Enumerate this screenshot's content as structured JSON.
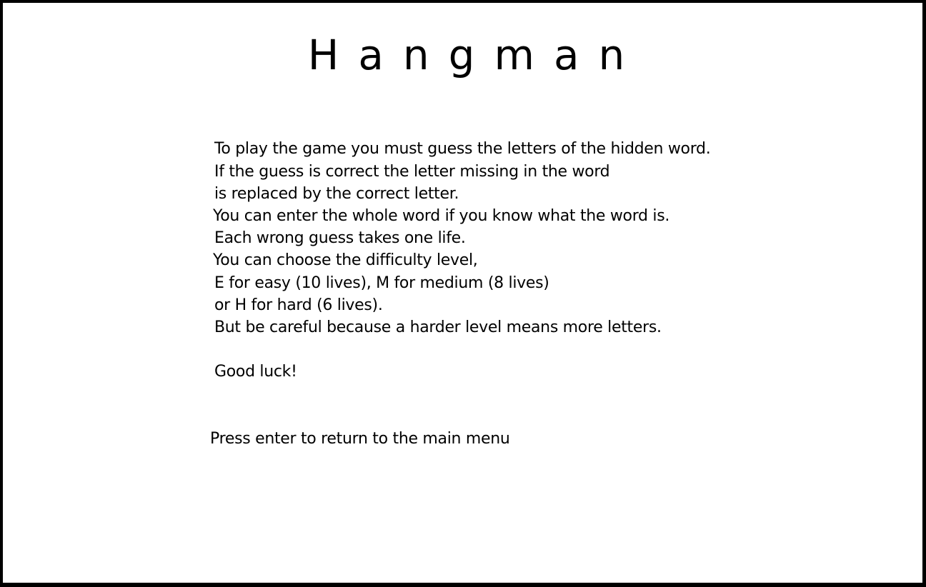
{
  "game": {
    "title": "Hangman",
    "instructions": [
      "To play the game you must guess the letters of the hidden word.",
      "If the guess is correct the letter missing in the word",
      "is replaced by the correct letter.",
      "You can enter the whole word if you know what the word is.",
      "Each wrong guess takes one life.",
      "You can choose the difficulty level,",
      "E for easy (10 lives), M for medium (8 lives)",
      "or H for hard (6 lives).",
      "But be careful because a harder level means more letters."
    ],
    "closing": "Good luck!",
    "prompt": "Press enter to return to the main menu"
  },
  "colors": {
    "background": "#ffffff",
    "text": "#000000",
    "border": "#000000"
  }
}
